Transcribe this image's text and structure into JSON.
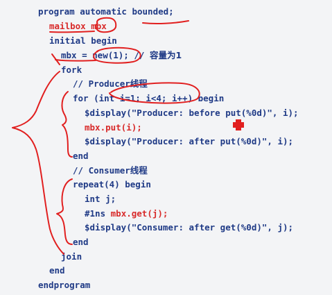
{
  "code": {
    "l1": "program automatic bounded;",
    "l2": "mailbox mbx",
    "l3": "initial begin",
    "l4a": "mbx = new(1); // ",
    "l4b": "容量为1",
    "l5": "fork",
    "l6": "// Producer线程",
    "l7": "for (int i=1; i<4; i++) begin",
    "l8": "$display(\"Producer: before put(%0d)\", i);",
    "l9": "mbx.put(i);",
    "l10": "$display(\"Producer: after put(%0d)\", i);",
    "l11": "end",
    "l12": "// Consumer线程",
    "l13": "repeat(4) begin",
    "l14": "int j;",
    "l15a": "#1ns ",
    "l15b": "mbx.get(j);",
    "l16": "$display(\"Consumer: after get(%0d)\", j);",
    "l17": "end",
    "l18": "join",
    "l19": "end",
    "l20": "endprogram"
  },
  "colors": {
    "code_blue": "#1f3a86",
    "code_red": "#d82a2a",
    "annotation_red": "#e11f1f",
    "background": "#f3f4f6"
  }
}
